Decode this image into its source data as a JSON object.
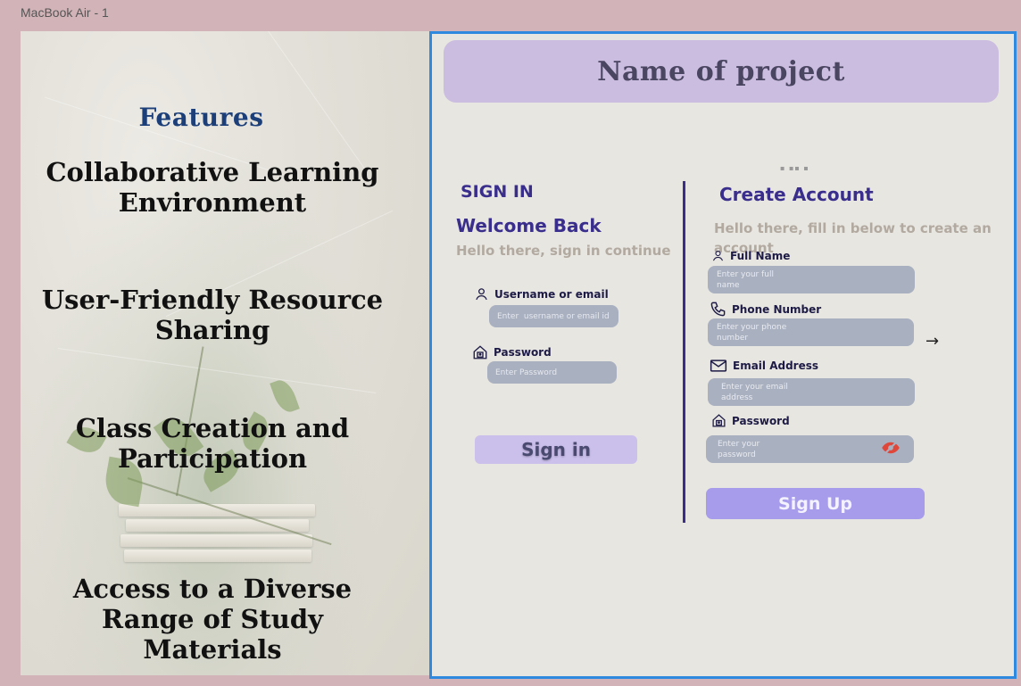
{
  "frame": {
    "label": "MacBook Air - 1"
  },
  "features": {
    "title": "Features",
    "items": [
      {
        "line1": "Collaborative Learning",
        "line2": "Environment",
        "line3": ""
      },
      {
        "line1": "User-Friendly Resource",
        "line2": "Sharing",
        "line3": ""
      },
      {
        "line1": "Class Creation and",
        "line2": "Participation",
        "line3": ""
      },
      {
        "line1": "Access to a Diverse",
        "line2": "Range of Study",
        "line3": "Materials"
      }
    ]
  },
  "project": {
    "title": "Name of project"
  },
  "signin": {
    "heading": "SIGN IN",
    "welcome": "Welcome Back",
    "subtitle": "Hello there, sign in continue",
    "username_label": "Username or email",
    "username_placeholder": "Enter  username or email id",
    "password_label": "Password",
    "password_placeholder": "Enter Password",
    "button": "Sign in"
  },
  "signup": {
    "heading": "Create Account",
    "subtitle_line1": "Hello there, fill in below to create an",
    "subtitle_line2": "account",
    "fullname_label": "Full Name",
    "fullname_placeholder_1": "Enter your full",
    "fullname_placeholder_2": "name",
    "phone_label": "Phone Number",
    "phone_placeholder_1": "Enter your phone",
    "phone_placeholder_2": "number",
    "email_label": "Email Address",
    "email_placeholder_1": "Enter your email",
    "email_placeholder_2": "address",
    "password_label": "Password",
    "password_placeholder_1": "Enter your",
    "password_placeholder_2": "password",
    "button": "Sign Up"
  },
  "icons": {
    "user": "user-icon",
    "lock": "lock-icon",
    "phone": "phone-icon",
    "mail": "mail-icon",
    "eye_off": "eye-off-icon",
    "arrow": "arrow-right-icon"
  },
  "colors": {
    "accent": "#3a2e8c",
    "banner": "#cbbde0",
    "signup_button": "#a69ceb",
    "signin_button": "#cbbfec",
    "frame_border": "#2f8adf"
  }
}
